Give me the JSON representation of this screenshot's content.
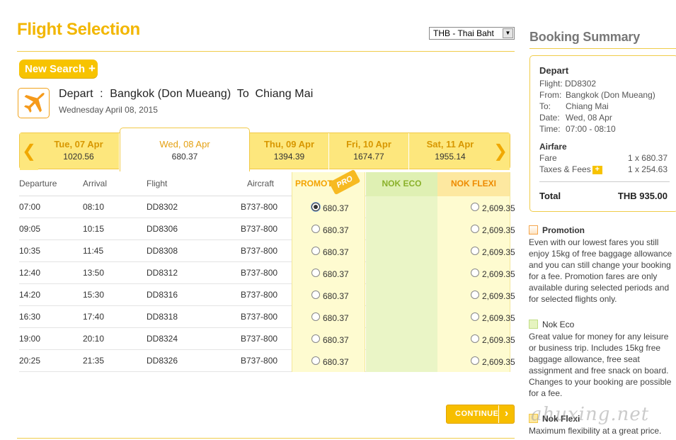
{
  "page": {
    "title": "Flight Selection"
  },
  "currency": {
    "selected": "THB - Thai Baht"
  },
  "new_search": {
    "label": "New Search",
    "plus": "+"
  },
  "route": {
    "depart_label": "Depart",
    "separator": ":",
    "origin": "Bangkok (Don Mueang)",
    "to_label": "To",
    "destination": "Chiang Mai",
    "date": "Wednesday April 08, 2015"
  },
  "date_tabs": [
    {
      "day": "Tue, 07 Apr",
      "price": "1020.56",
      "active": false
    },
    {
      "day": "Wed, 08 Apr",
      "price": "680.37",
      "active": true
    },
    {
      "day": "Thu, 09 Apr",
      "price": "1394.39",
      "active": false
    },
    {
      "day": "Fri, 10 Apr",
      "price": "1674.77",
      "active": false
    },
    {
      "day": "Sat, 11 Apr",
      "price": "1955.14",
      "active": false
    }
  ],
  "nav": {
    "prev": "❮",
    "next": "❯"
  },
  "table": {
    "headers": {
      "departure": "Departure",
      "arrival": "Arrival",
      "flight": "Flight",
      "aircraft": "Aircraft",
      "promo": "PROMOTION",
      "promo_tag": "PRO",
      "eco": "NOK ECO",
      "flexi": "NOK FLEXI"
    },
    "rows": [
      {
        "dep": "07:00",
        "arr": "08:10",
        "flight": "DD8302",
        "aircraft": "B737-800",
        "promo": "680.37",
        "flexi": "2,609.35",
        "selected": true
      },
      {
        "dep": "09:05",
        "arr": "10:15",
        "flight": "DD8306",
        "aircraft": "B737-800",
        "promo": "680.37",
        "flexi": "2,609.35",
        "selected": false
      },
      {
        "dep": "10:35",
        "arr": "11:45",
        "flight": "DD8308",
        "aircraft": "B737-800",
        "promo": "680.37",
        "flexi": "2,609.35",
        "selected": false
      },
      {
        "dep": "12:40",
        "arr": "13:50",
        "flight": "DD8312",
        "aircraft": "B737-800",
        "promo": "680.37",
        "flexi": "2,609.35",
        "selected": false
      },
      {
        "dep": "14:20",
        "arr": "15:30",
        "flight": "DD8316",
        "aircraft": "B737-800",
        "promo": "680.37",
        "flexi": "2,609.35",
        "selected": false
      },
      {
        "dep": "16:30",
        "arr": "17:40",
        "flight": "DD8318",
        "aircraft": "B737-800",
        "promo": "680.37",
        "flexi": "2,609.35",
        "selected": false
      },
      {
        "dep": "19:00",
        "arr": "20:10",
        "flight": "DD8324",
        "aircraft": "B737-800",
        "promo": "680.37",
        "flexi": "2,609.35",
        "selected": false
      },
      {
        "dep": "20:25",
        "arr": "21:35",
        "flight": "DD8326",
        "aircraft": "B737-800",
        "promo": "680.37",
        "flexi": "2,609.35",
        "selected": false
      }
    ]
  },
  "continue": {
    "label": "CONTINUE",
    "chevron": "›"
  },
  "booking_summary": {
    "title": "Booking Summary",
    "depart_heading": "Depart",
    "flight": "Flight: DD8302",
    "from_label": "From:",
    "from_value": "Bangkok (Don Mueang)",
    "to_label": "To:",
    "to_value": "Chiang Mai",
    "date_label": "Date:",
    "date_value": "Wed, 08 Apr",
    "time_label": "Time:",
    "time_value": "07:00 - 08:10",
    "airfare_heading": "Airfare",
    "fare_label": "Fare",
    "fare_value": "1 x 680.37",
    "taxes_label": "Taxes & Fees",
    "taxes_plus": "+",
    "taxes_value": "1 x 254.63",
    "total_label": "Total",
    "total_value": "THB 935.00"
  },
  "info": {
    "promotion": {
      "title": "Promotion",
      "text": "Even with our lowest fares you still enjoy 15kg of free baggage allowance and you can still change your booking for a fee. Promotion fares are only available during selected periods and for selected flights only."
    },
    "eco": {
      "title": "Nok Eco",
      "text": "Great value for money for any leisure or business trip. Includes 15kg free baggage allowance, free seat assignment and free snack on board. Changes to your booking are possible for a fee."
    },
    "flexi": {
      "title": "Nok Flexi",
      "text": "Maximum flexibility at a great price."
    }
  },
  "watermark": {
    "text": "ahuxing.net"
  },
  "colors": {
    "accent": "#f7c300",
    "promo": "#fefbd0",
    "eco": "#dff0b3",
    "flexi": "#fde8a0"
  },
  "icons": {
    "plane": "airplane-icon",
    "select": "chevron-down-icon"
  }
}
